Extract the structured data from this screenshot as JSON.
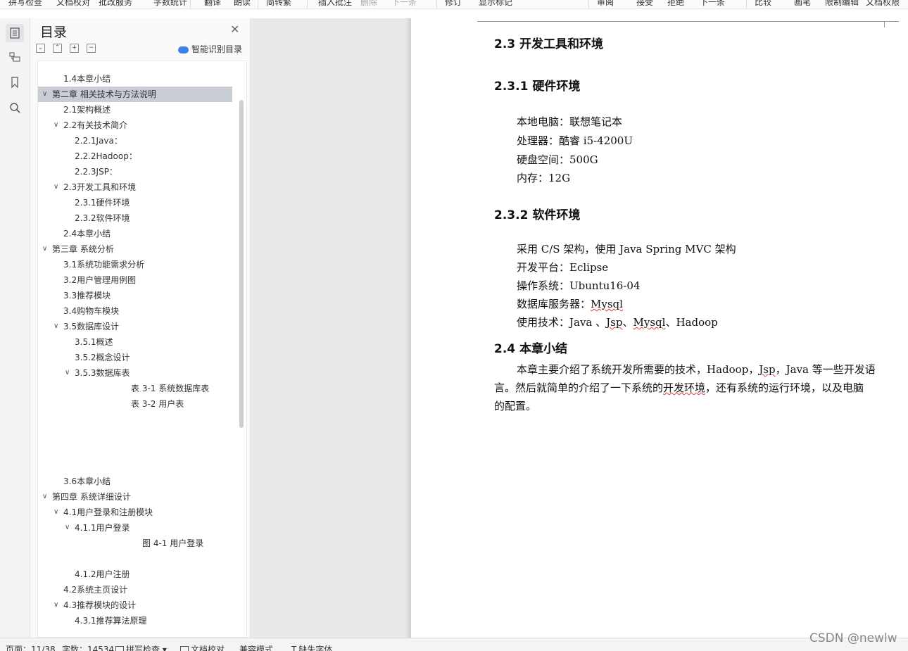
{
  "toolbar": {
    "items": [
      {
        "label": "拼写检查",
        "x_hint": "a",
        "dim": false
      },
      {
        "label": "文档校对",
        "dim": false
      },
      {
        "label": "批改服务",
        "dim": false
      },
      {
        "label": "字数统计",
        "dim": false
      },
      {
        "label": "翻译",
        "dim": false
      },
      {
        "label": "朗读",
        "dim": false
      },
      {
        "label": "简转繁",
        "dim": false
      },
      {
        "label": "插入批注",
        "dim": false
      },
      {
        "label": "删除",
        "dim": true
      },
      {
        "label": "下一条",
        "dim": true
      },
      {
        "label": "修订",
        "dim": false
      },
      {
        "label": "显示标记",
        "dim": false
      },
      {
        "label": "审阅",
        "dim": false
      },
      {
        "label": "接受",
        "dim": false
      },
      {
        "label": "拒绝",
        "dim": false
      },
      {
        "label": "下一条",
        "dim": false
      },
      {
        "label": "比较",
        "dim": false
      },
      {
        "label": "画笔",
        "dim": false
      },
      {
        "label": "限制编辑",
        "dim": false
      },
      {
        "label": "文档权限",
        "dim": false
      }
    ]
  },
  "toc_panel": {
    "title": "目录",
    "smart_label": "智能识别目录",
    "items": [
      {
        "text": "1.4本章小结",
        "level": 2,
        "chev": false,
        "sel": false
      },
      {
        "text": "第二章 相关技术与方法说明",
        "level": 1,
        "chev": true,
        "sel": true
      },
      {
        "text": "2.1架构概述",
        "level": 2,
        "chev": false,
        "sel": false
      },
      {
        "text": "2.2有关技术简介",
        "level": 2,
        "chev": true,
        "sel": false
      },
      {
        "text": "2.2.1Java：",
        "level": 3,
        "chev": false,
        "sel": false
      },
      {
        "text": "2.2.2Hadoop：",
        "level": 3,
        "chev": false,
        "sel": false
      },
      {
        "text": "2.2.3JSP：",
        "level": 3,
        "chev": false,
        "sel": false
      },
      {
        "text": "2.3开发工具和环境",
        "level": 2,
        "chev": true,
        "sel": false
      },
      {
        "text": "2.3.1硬件环境",
        "level": 3,
        "chev": false,
        "sel": false
      },
      {
        "text": "2.3.2软件环境",
        "level": 3,
        "chev": false,
        "sel": false
      },
      {
        "text": "2.4本章小结",
        "level": 2,
        "chev": false,
        "sel": false
      },
      {
        "text": "第三章 系统分析",
        "level": 1,
        "chev": true,
        "sel": false
      },
      {
        "text": "3.1系统功能需求分析",
        "level": 2,
        "chev": false,
        "sel": false
      },
      {
        "text": "3.2用户管理用例图",
        "level": 2,
        "chev": false,
        "sel": false
      },
      {
        "text": "3.3推荐模块",
        "level": 2,
        "chev": false,
        "sel": false
      },
      {
        "text": "3.4购物车模块",
        "level": 2,
        "chev": false,
        "sel": false
      },
      {
        "text": "3.5数据库设计",
        "level": 2,
        "chev": true,
        "sel": false
      },
      {
        "text": "3.5.1概述",
        "level": 3,
        "chev": false,
        "sel": false
      },
      {
        "text": "3.5.2概念设计",
        "level": 3,
        "chev": false,
        "sel": false
      },
      {
        "text": "3.5.3数据库表",
        "level": 3,
        "chev": true,
        "sel": false
      },
      {
        "text": "表 3-1  系统数据库表",
        "level": 5,
        "chev": false,
        "sel": false
      },
      {
        "text": "表 3-2  用户表",
        "level": 5,
        "chev": false,
        "sel": false
      },
      {
        "text": "3.6本章小结",
        "level": 2,
        "chev": false,
        "sel": false
      },
      {
        "text": "第四章 系统详细设计",
        "level": 1,
        "chev": true,
        "sel": false
      },
      {
        "text": "4.1用户登录和注册模块",
        "level": 2,
        "chev": true,
        "sel": false
      },
      {
        "text": "4.1.1用户登录",
        "level": 3,
        "chev": true,
        "sel": false
      },
      {
        "text": "图 4-1    用户登录",
        "level": 6,
        "chev": false,
        "sel": false
      },
      {
        "text": "4.1.2用户注册",
        "level": 3,
        "chev": false,
        "sel": false
      },
      {
        "text": "4.2系统主页设计",
        "level": 2,
        "chev": false,
        "sel": false
      },
      {
        "text": "4.3推荐模块的设计",
        "level": 2,
        "chev": true,
        "sel": false
      },
      {
        "text": "4.3.1推荐算法原理",
        "level": 3,
        "chev": false,
        "sel": false
      }
    ]
  },
  "document": {
    "h_2_3": "2.3  开发工具和环境",
    "h_2_3_1": "2.3.1  硬件环境",
    "hw": [
      "本地电脑：联想笔记本",
      "处理器：酷睿 i5-4200U",
      "硬盘空间：500G",
      "内存：12G"
    ],
    "h_2_3_2": "2.3.2  软件环境",
    "sw1": "采用 C/S 架构，使用 Java Spring MVC 架构",
    "sw2": "开发平台：Eclipse",
    "sw3": "操作系统：Ubuntu16-04",
    "sw4_prefix": "数据库服务器：",
    "sw4_word": "Mysql",
    "sw5_prefix": "使用技术：Java  、",
    "sw5_jsp": "Jsp",
    "sw5_sep": "、",
    "sw5_mysql": "Mysql",
    "sw5_tail": "、Hadoop",
    "h_2_4": "2.4  本章小结",
    "para_l1a": "本章主要介绍了系统开发所需要的技术，Hadoop，",
    "para_l1b": "Jsp",
    "para_l1c": "，Java 等一些开发语",
    "para_l2a": "言。然后就简单的介绍了一下系统的",
    "para_l2b": "开发环境",
    "para_l2c": "，还有系统的运行环境，以及电脑",
    "para_l3": "的配置。"
  },
  "status": {
    "page": "页面：11/38",
    "words": "字数：14534",
    "spell": "拼写检查",
    "proof": "文档校对",
    "compat": "兼容模式",
    "missing_font": "缺失字体"
  },
  "watermark": "CSDN @newlw"
}
